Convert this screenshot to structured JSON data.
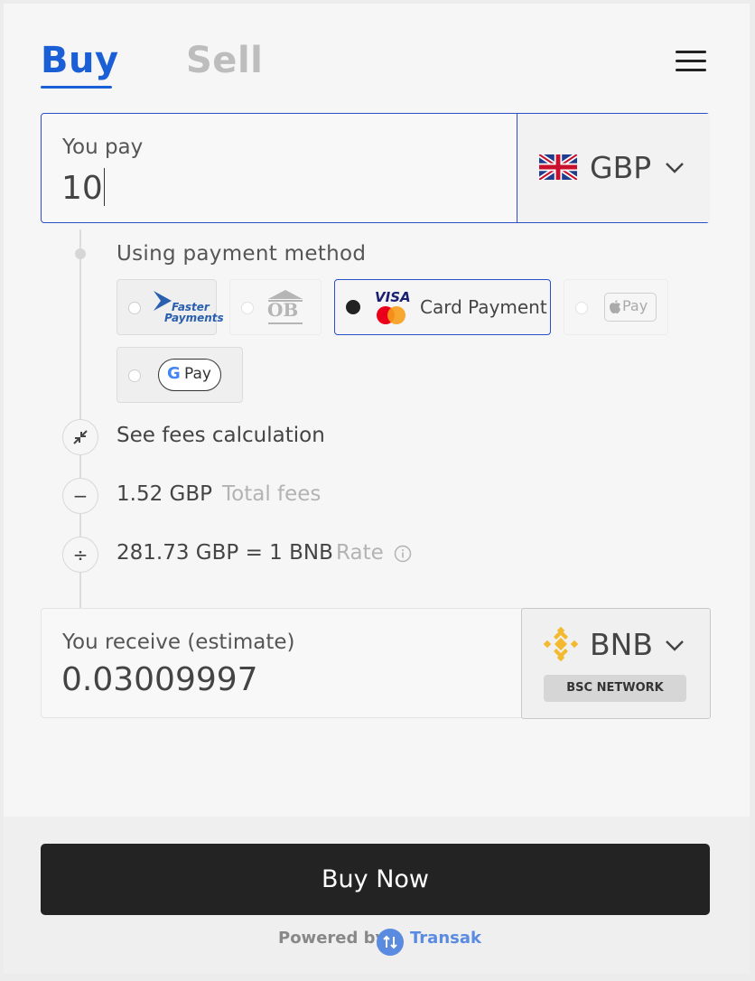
{
  "tabs": {
    "buy": "Buy",
    "sell": "Sell"
  },
  "pay": {
    "label": "You pay",
    "value": "10",
    "currency": "GBP"
  },
  "payment_method": {
    "title": "Using payment method",
    "options": [
      {
        "name": "Faster Payments",
        "line1": "Faster",
        "line2": "Payments",
        "selected": false
      },
      {
        "name": "Open Banking",
        "text": "OB",
        "selected": false
      },
      {
        "name": "Card Payment",
        "label": "Card Payment",
        "visa": "VISA",
        "selected": true
      },
      {
        "name": "Apple Pay",
        "label": "Pay",
        "selected": false
      },
      {
        "name": "Google Pay",
        "label": "Pay",
        "selected": false
      }
    ]
  },
  "fees": {
    "toggle_label": "See fees calculation",
    "total_value": "1.52 GBP",
    "total_label": "Total fees",
    "rate_value": "281.73 GBP = 1 BNB",
    "rate_label": "Rate"
  },
  "receive": {
    "label": "You receive (estimate)",
    "value": "0.03009997",
    "currency": "BNB",
    "network": "BSC NETWORK"
  },
  "footer": {
    "button": "Buy Now",
    "powered_by": "Powered by",
    "brand": "Transak"
  },
  "colors": {
    "accent": "#1a5fd6",
    "button": "#232323",
    "binance": "#f3ba2f",
    "brand": "#5a8be0"
  }
}
